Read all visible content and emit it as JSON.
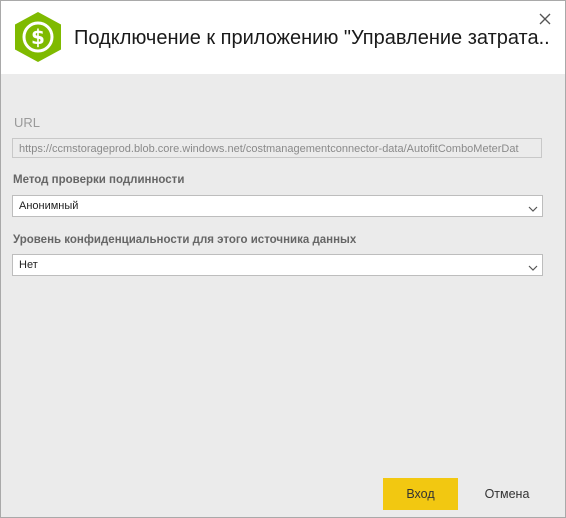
{
  "dialog": {
    "title": "Подключение к приложению \"Управление затрата...",
    "app_icon": "dollar-hexagon-icon",
    "close_icon": "close-icon"
  },
  "url": {
    "label": "URL",
    "value": "https://ccmstorageprod.blob.core.windows.net/costmanagementconnector-data/AutofitComboMeterDat"
  },
  "auth": {
    "label": "Метод проверки подлинности",
    "selected": "Анонимный"
  },
  "privacy": {
    "label": "Уровень конфиденциальности для этого источника данных",
    "selected": "Нет"
  },
  "buttons": {
    "connect": "Вход",
    "cancel": "Отмена"
  },
  "colors": {
    "accent": "#f2c811",
    "icon_green": "#7fba00",
    "dialog_bg": "#ebebeb"
  }
}
